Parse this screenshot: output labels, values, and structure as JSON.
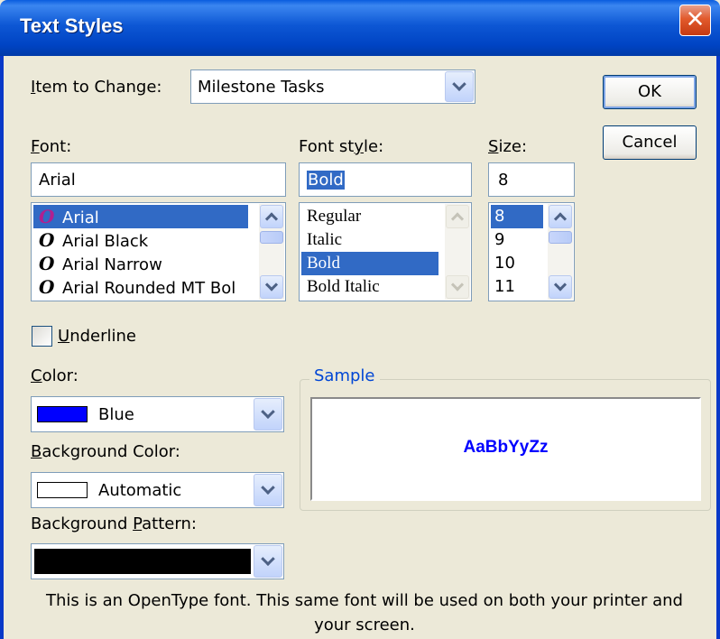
{
  "window": {
    "title": "Text Styles",
    "close_glyph": "✕"
  },
  "item_to_change": {
    "label": "Item to Change:",
    "mnemonic": "I",
    "rest": "tem to Change:",
    "value": "Milestone Tasks"
  },
  "buttons": {
    "ok": "OK",
    "cancel": "Cancel"
  },
  "font": {
    "label_mnemonic": "F",
    "label_rest": "ont:",
    "value": "Arial",
    "icon_glyph": "O",
    "items": [
      {
        "label": "Arial",
        "selected": true
      },
      {
        "label": "Arial Black",
        "selected": false
      },
      {
        "label": "Arial Narrow",
        "selected": false
      },
      {
        "label": "Arial Rounded MT Bol",
        "selected": false
      }
    ]
  },
  "font_style": {
    "label": "Font style:",
    "label_pre": "Font st",
    "label_mnemonic": "y",
    "label_post": "le:",
    "value": "Bold",
    "items": [
      {
        "label": "Regular",
        "selected": false
      },
      {
        "label": "Italic",
        "selected": false
      },
      {
        "label": "Bold",
        "selected": true
      },
      {
        "label": "Bold Italic",
        "selected": false
      }
    ]
  },
  "size": {
    "label_mnemonic": "S",
    "label_rest": "ize:",
    "value": "8",
    "items": [
      {
        "label": "8",
        "selected": true
      },
      {
        "label": "9",
        "selected": false
      },
      {
        "label": "10",
        "selected": false
      },
      {
        "label": "11",
        "selected": false
      }
    ]
  },
  "underline": {
    "mnemonic": "U",
    "rest": "nderline",
    "checked": false
  },
  "color": {
    "label_mnemonic": "C",
    "label_rest": "olor:",
    "value": "Blue",
    "swatch": "#0000ff"
  },
  "background_color": {
    "label_mnemonic": "B",
    "label_rest": "ackground Color:",
    "value": "Automatic",
    "swatch": "#ffffff"
  },
  "background_pattern": {
    "label_pre": "Background ",
    "label_mnemonic": "P",
    "label_post": "attern:",
    "swatch": "#000000"
  },
  "sample": {
    "legend": "Sample",
    "text": "AaBbYyZz",
    "color": "#0000ff"
  },
  "footer": {
    "line1": "This is an OpenType font. This same font will be used on both your printer and",
    "line2": "your screen."
  },
  "colors": {
    "title_bar": "#0054e3",
    "dialog_bg": "#ece9d8",
    "selection": "#316ac5",
    "accent": "#0046d5"
  }
}
